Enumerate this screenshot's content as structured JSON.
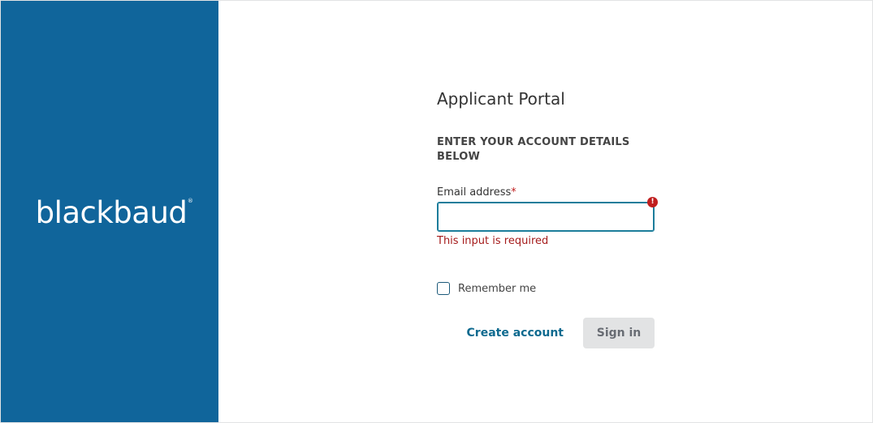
{
  "brand": {
    "logo_text": "blackbaud",
    "logo_mark": "®",
    "panel_color": "#10659b"
  },
  "form": {
    "title": "Applicant Portal",
    "subtitle": "ENTER YOUR ACCOUNT DETAILS BELOW",
    "email": {
      "label": "Email address",
      "required_mark": "*",
      "value": "",
      "placeholder": "",
      "error_icon": "!",
      "error_message": "This input is required"
    },
    "remember": {
      "label": "Remember me",
      "checked": false
    },
    "create_account_label": "Create account",
    "sign_in_label": "Sign in"
  },
  "colors": {
    "accent": "#0e6a8f",
    "error": "#c01e1e",
    "disabled_button": "#e2e3e4"
  }
}
